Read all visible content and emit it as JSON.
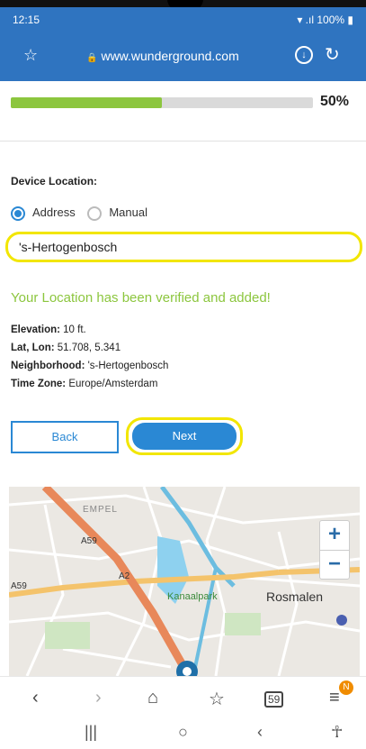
{
  "status_bar": {
    "time": "12:15",
    "right": "100%"
  },
  "browser": {
    "url": "www.wunderground.com"
  },
  "progress": {
    "value": 0.5,
    "label": "50%",
    "fill_color": "#8cc63e"
  },
  "form": {
    "device_location_label": "Device Location:",
    "options": [
      "Address",
      "Manual"
    ],
    "selected_option": "Address",
    "address_value": "'s-Hertogenbosch",
    "verified_message": "Your Location has been verified and added!",
    "info": [
      {
        "key": "Elevation:",
        "value": " 10 ft."
      },
      {
        "key": "Lat, Lon:",
        "value": " 51.708, 5.341"
      },
      {
        "key": "Neighborhood:",
        "value": " 's-Hertogenbosch"
      },
      {
        "key": "Time Zone:",
        "value": " Europe/Amsterdam"
      }
    ],
    "back_label": "Back",
    "next_label": "Next"
  },
  "map": {
    "labels": {
      "empfel": "EMPEL",
      "kanaalpark": "Kanaalpark",
      "rosmalen": "Rosmalen",
      "a59_a": "A59",
      "a59_b": "A59",
      "a2": "A2"
    },
    "zoom_in": "+",
    "zoom_out": "−"
  },
  "bottom_nav": {
    "icons": [
      "back-icon",
      "forward-icon",
      "home-icon",
      "favorites-icon",
      "tabs-icon",
      "menu-icon"
    ],
    "tabs_count": "59",
    "badge": "N"
  },
  "colors": {
    "accent": "#2a88d4",
    "chrome": "#2f74c0",
    "highlight": "#f2e600",
    "success": "#8cc63e"
  }
}
